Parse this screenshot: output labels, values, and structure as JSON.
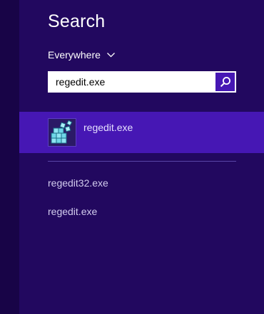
{
  "search_pane": {
    "title": "Search",
    "scope": "Everywhere",
    "query": "regedit.exe"
  },
  "icons": {
    "scope_toggle": "chevron-down-icon",
    "search_button": "magnifier-icon",
    "app_icon": "registry-editor-icon"
  },
  "results": {
    "selected_app": "regedit.exe",
    "suggestions": [
      "regedit32.exe",
      "regedit.exe"
    ]
  },
  "colors": {
    "background": "#22085f",
    "accent": "#4617b4"
  }
}
